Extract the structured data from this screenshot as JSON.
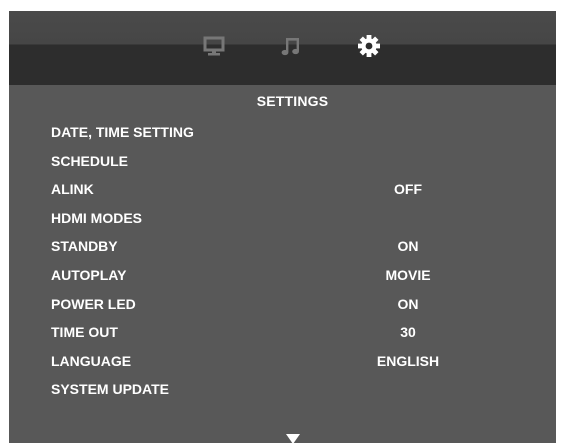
{
  "header": {
    "tabs": [
      {
        "icon": "monitor-icon",
        "active": false
      },
      {
        "icon": "music-note-icon",
        "active": false
      },
      {
        "icon": "gear-icon",
        "active": true
      }
    ]
  },
  "title": "SETTINGS",
  "menu": [
    {
      "label": "DATE, TIME SETTING",
      "value": ""
    },
    {
      "label": "SCHEDULE",
      "value": ""
    },
    {
      "label": "ALINK",
      "value": "OFF"
    },
    {
      "label": "HDMI MODES",
      "value": ""
    },
    {
      "label": "STANDBY",
      "value": "ON"
    },
    {
      "label": "AUTOPLAY",
      "value": "MOVIE"
    },
    {
      "label": "POWER LED",
      "value": "ON"
    },
    {
      "label": "TIME OUT",
      "value": "30"
    },
    {
      "label": "LANGUAGE",
      "value": "ENGLISH"
    },
    {
      "label": "SYSTEM UPDATE",
      "value": ""
    }
  ],
  "colors": {
    "background": "#585858",
    "header_band": "#2d2d2d",
    "text": "#ffffff",
    "inactive_icon": "#777777",
    "active_icon": "#ffffff"
  }
}
